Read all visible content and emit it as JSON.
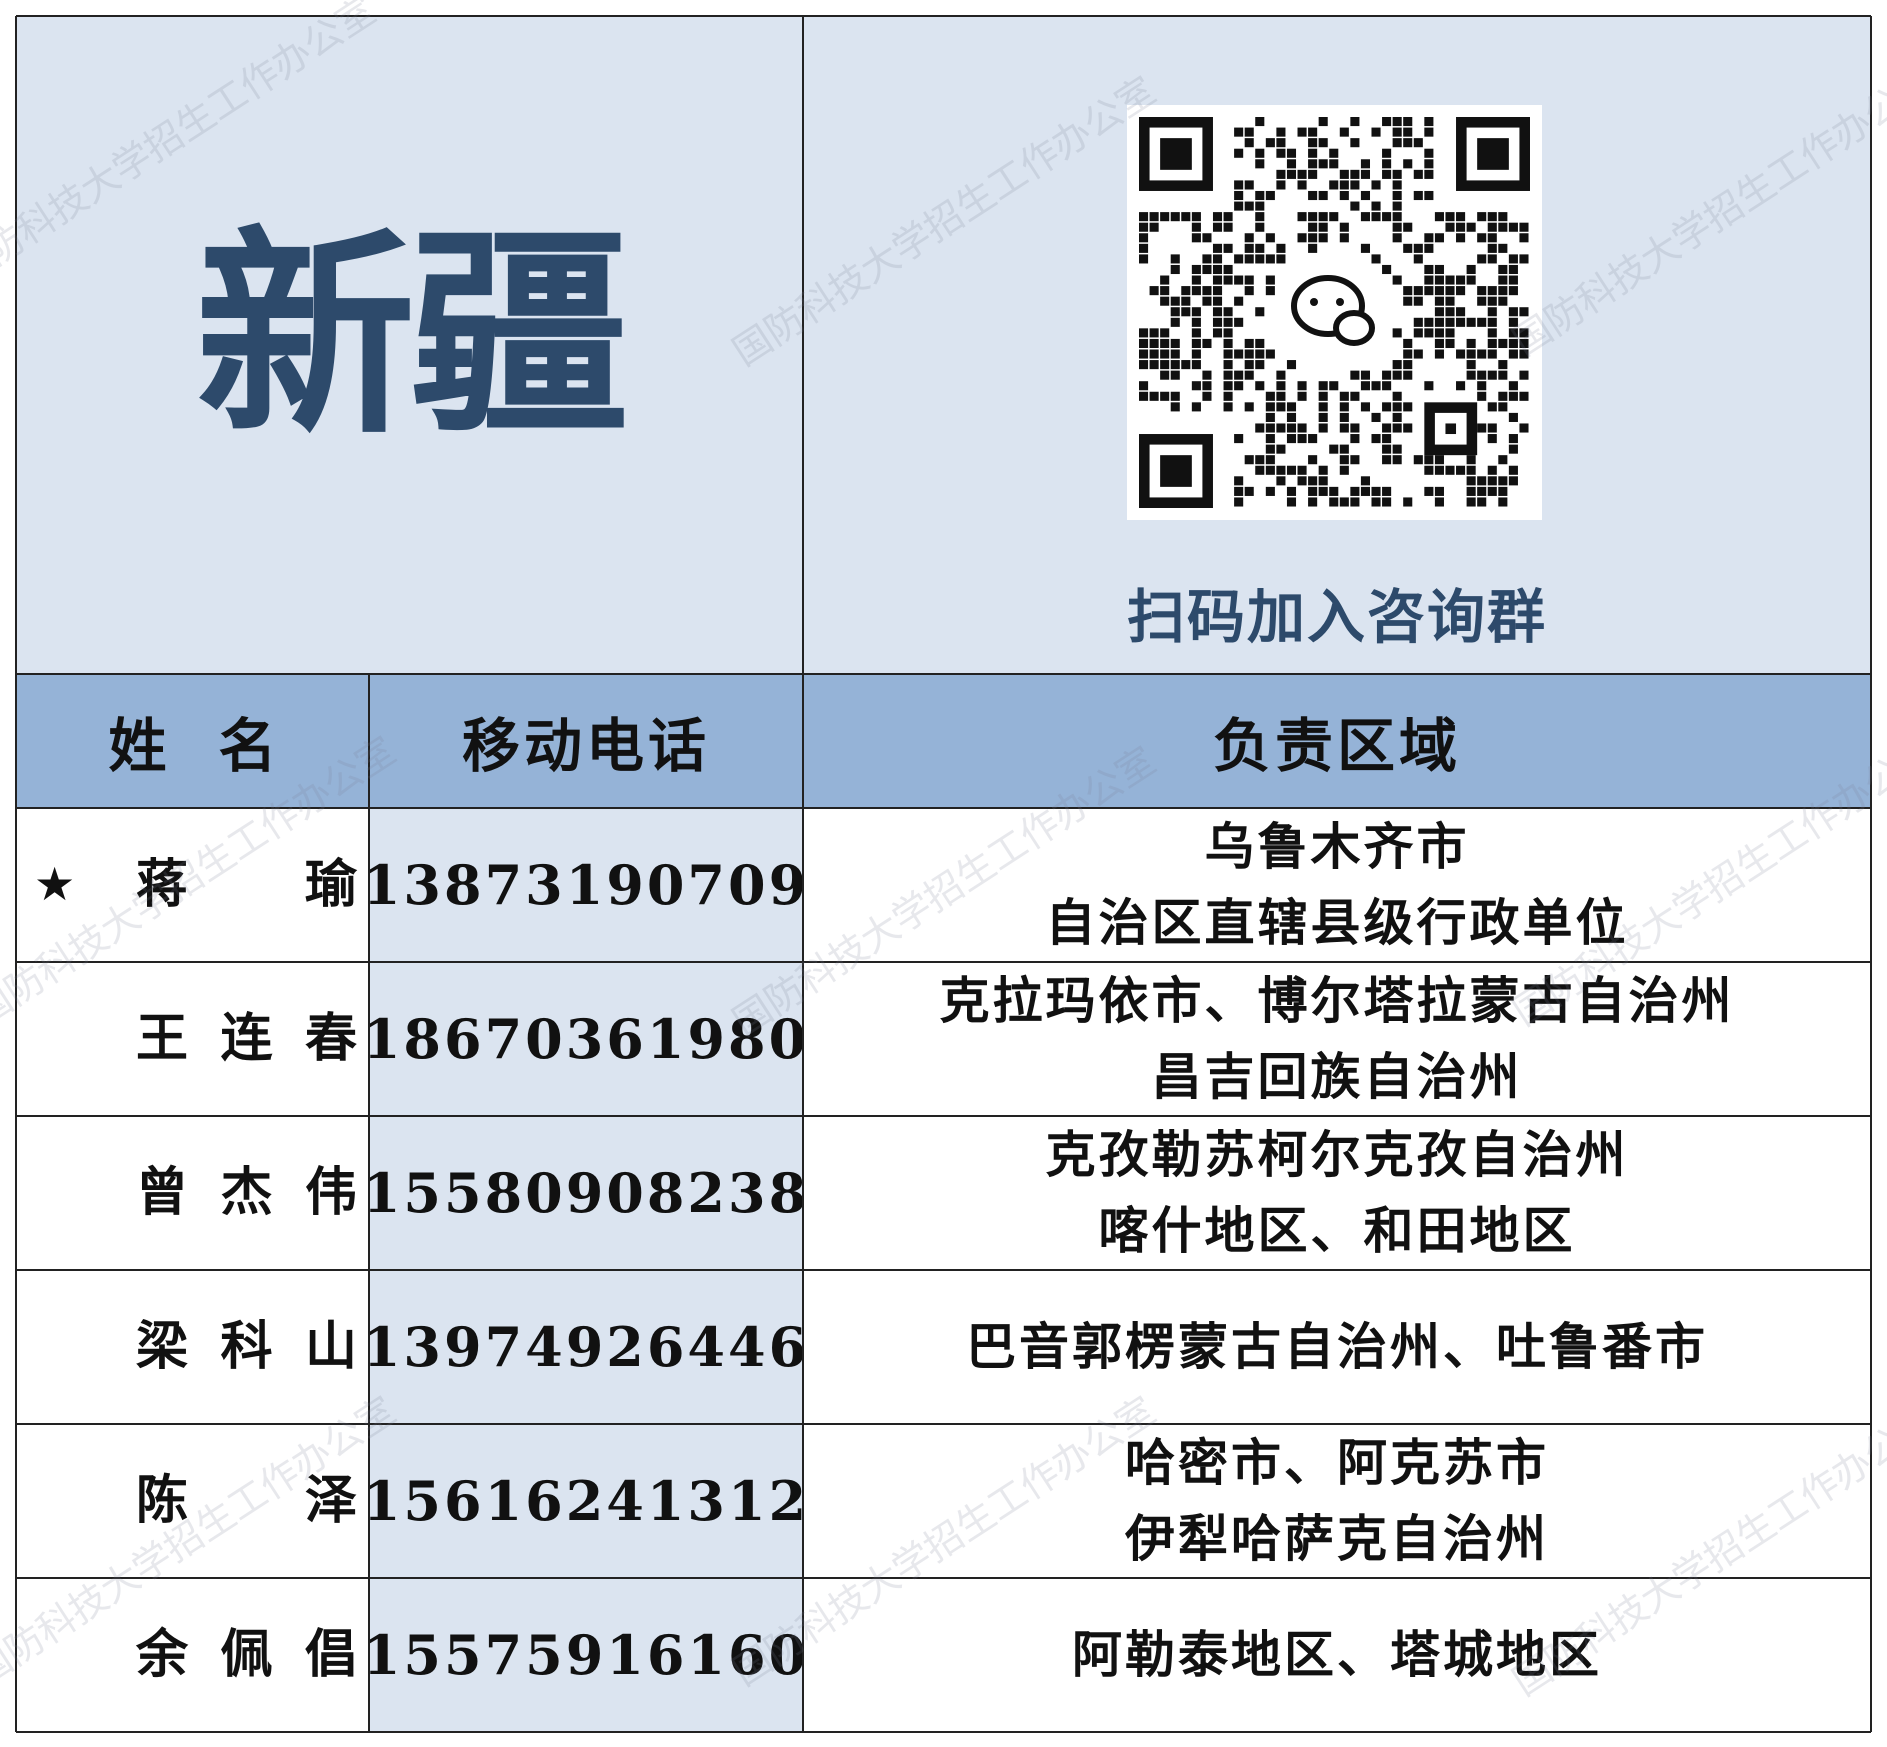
{
  "region_title": "新疆",
  "qr_caption": "扫码加入咨询群",
  "watermark": "国防科技大学招生工作办公室",
  "colors": {
    "title_blue": "#2d4a6b",
    "panel_bg": "#dbe4f0",
    "header_bg": "#95b3d7"
  },
  "table": {
    "headers": {
      "name": "姓名",
      "phone": "移动电话",
      "region": "负责区域"
    },
    "rows": [
      {
        "star": "★",
        "name_chars": [
          "蒋",
          "瑜"
        ],
        "phone": "13873190709",
        "region_lines": [
          "乌鲁木齐市",
          "自治区直辖县级行政单位"
        ]
      },
      {
        "star": "",
        "name_chars": [
          "王",
          "连",
          "春"
        ],
        "phone": "18670361980",
        "region_lines": [
          "克拉玛依市、博尔塔拉蒙古自治州",
          "昌吉回族自治州"
        ]
      },
      {
        "star": "",
        "name_chars": [
          "曾",
          "杰",
          "伟"
        ],
        "phone": "15580908238",
        "region_lines": [
          "克孜勒苏柯尔克孜自治州",
          "喀什地区、和田地区"
        ]
      },
      {
        "star": "",
        "name_chars": [
          "梁",
          "科",
          "山"
        ],
        "phone": "13974926446",
        "region_lines": [
          "巴音郭楞蒙古自治州、吐鲁番市"
        ]
      },
      {
        "star": "",
        "name_chars": [
          "陈",
          "泽"
        ],
        "phone": "15616241312",
        "region_lines": [
          "哈密市、阿克苏市",
          "伊犁哈萨克自治州"
        ]
      },
      {
        "star": "",
        "name_chars": [
          "余",
          "佩",
          "倡"
        ],
        "phone": "15575916160",
        "region_lines": [
          "阿勒泰地区、塔城地区"
        ]
      }
    ]
  }
}
